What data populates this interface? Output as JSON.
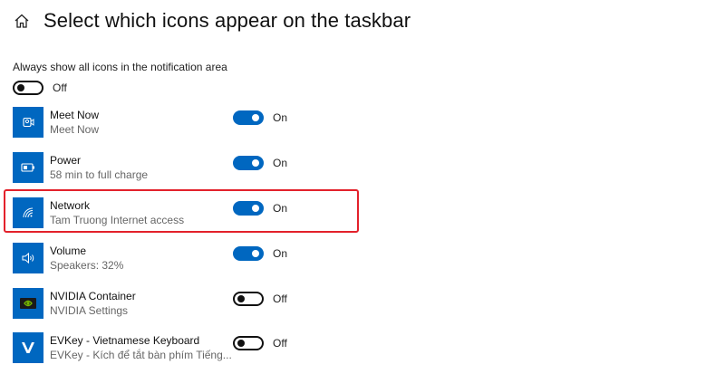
{
  "page": {
    "title": "Select which icons appear on the taskbar"
  },
  "always_show": {
    "label": "Always show all icons in the notification area",
    "state": "Off",
    "on": false
  },
  "apps": [
    {
      "name": "Meet Now",
      "subtitle": "Meet Now",
      "state": "On",
      "on": true,
      "icon": "meet-now-icon"
    },
    {
      "name": "Power",
      "subtitle": "58 min to full charge",
      "state": "On",
      "on": true,
      "icon": "battery-icon"
    },
    {
      "name": "Network",
      "subtitle": "Tam Truong Internet access",
      "state": "On",
      "on": true,
      "icon": "wifi-icon"
    },
    {
      "name": "Volume",
      "subtitle": "Speakers: 32%",
      "state": "On",
      "on": true,
      "icon": "speaker-icon"
    },
    {
      "name": "NVIDIA Container",
      "subtitle": "NVIDIA Settings",
      "state": "Off",
      "on": false,
      "icon": "nvidia-icon"
    },
    {
      "name": "EVKey - Vietnamese Keyboard",
      "subtitle": "EVKey - Kích để tắt bàn phím Tiếng...",
      "state": "Off",
      "on": false,
      "icon": "evkey-icon"
    }
  ],
  "colors": {
    "accent": "#0067c0",
    "highlight": "#e3212b",
    "nvidia": "#76b900"
  }
}
